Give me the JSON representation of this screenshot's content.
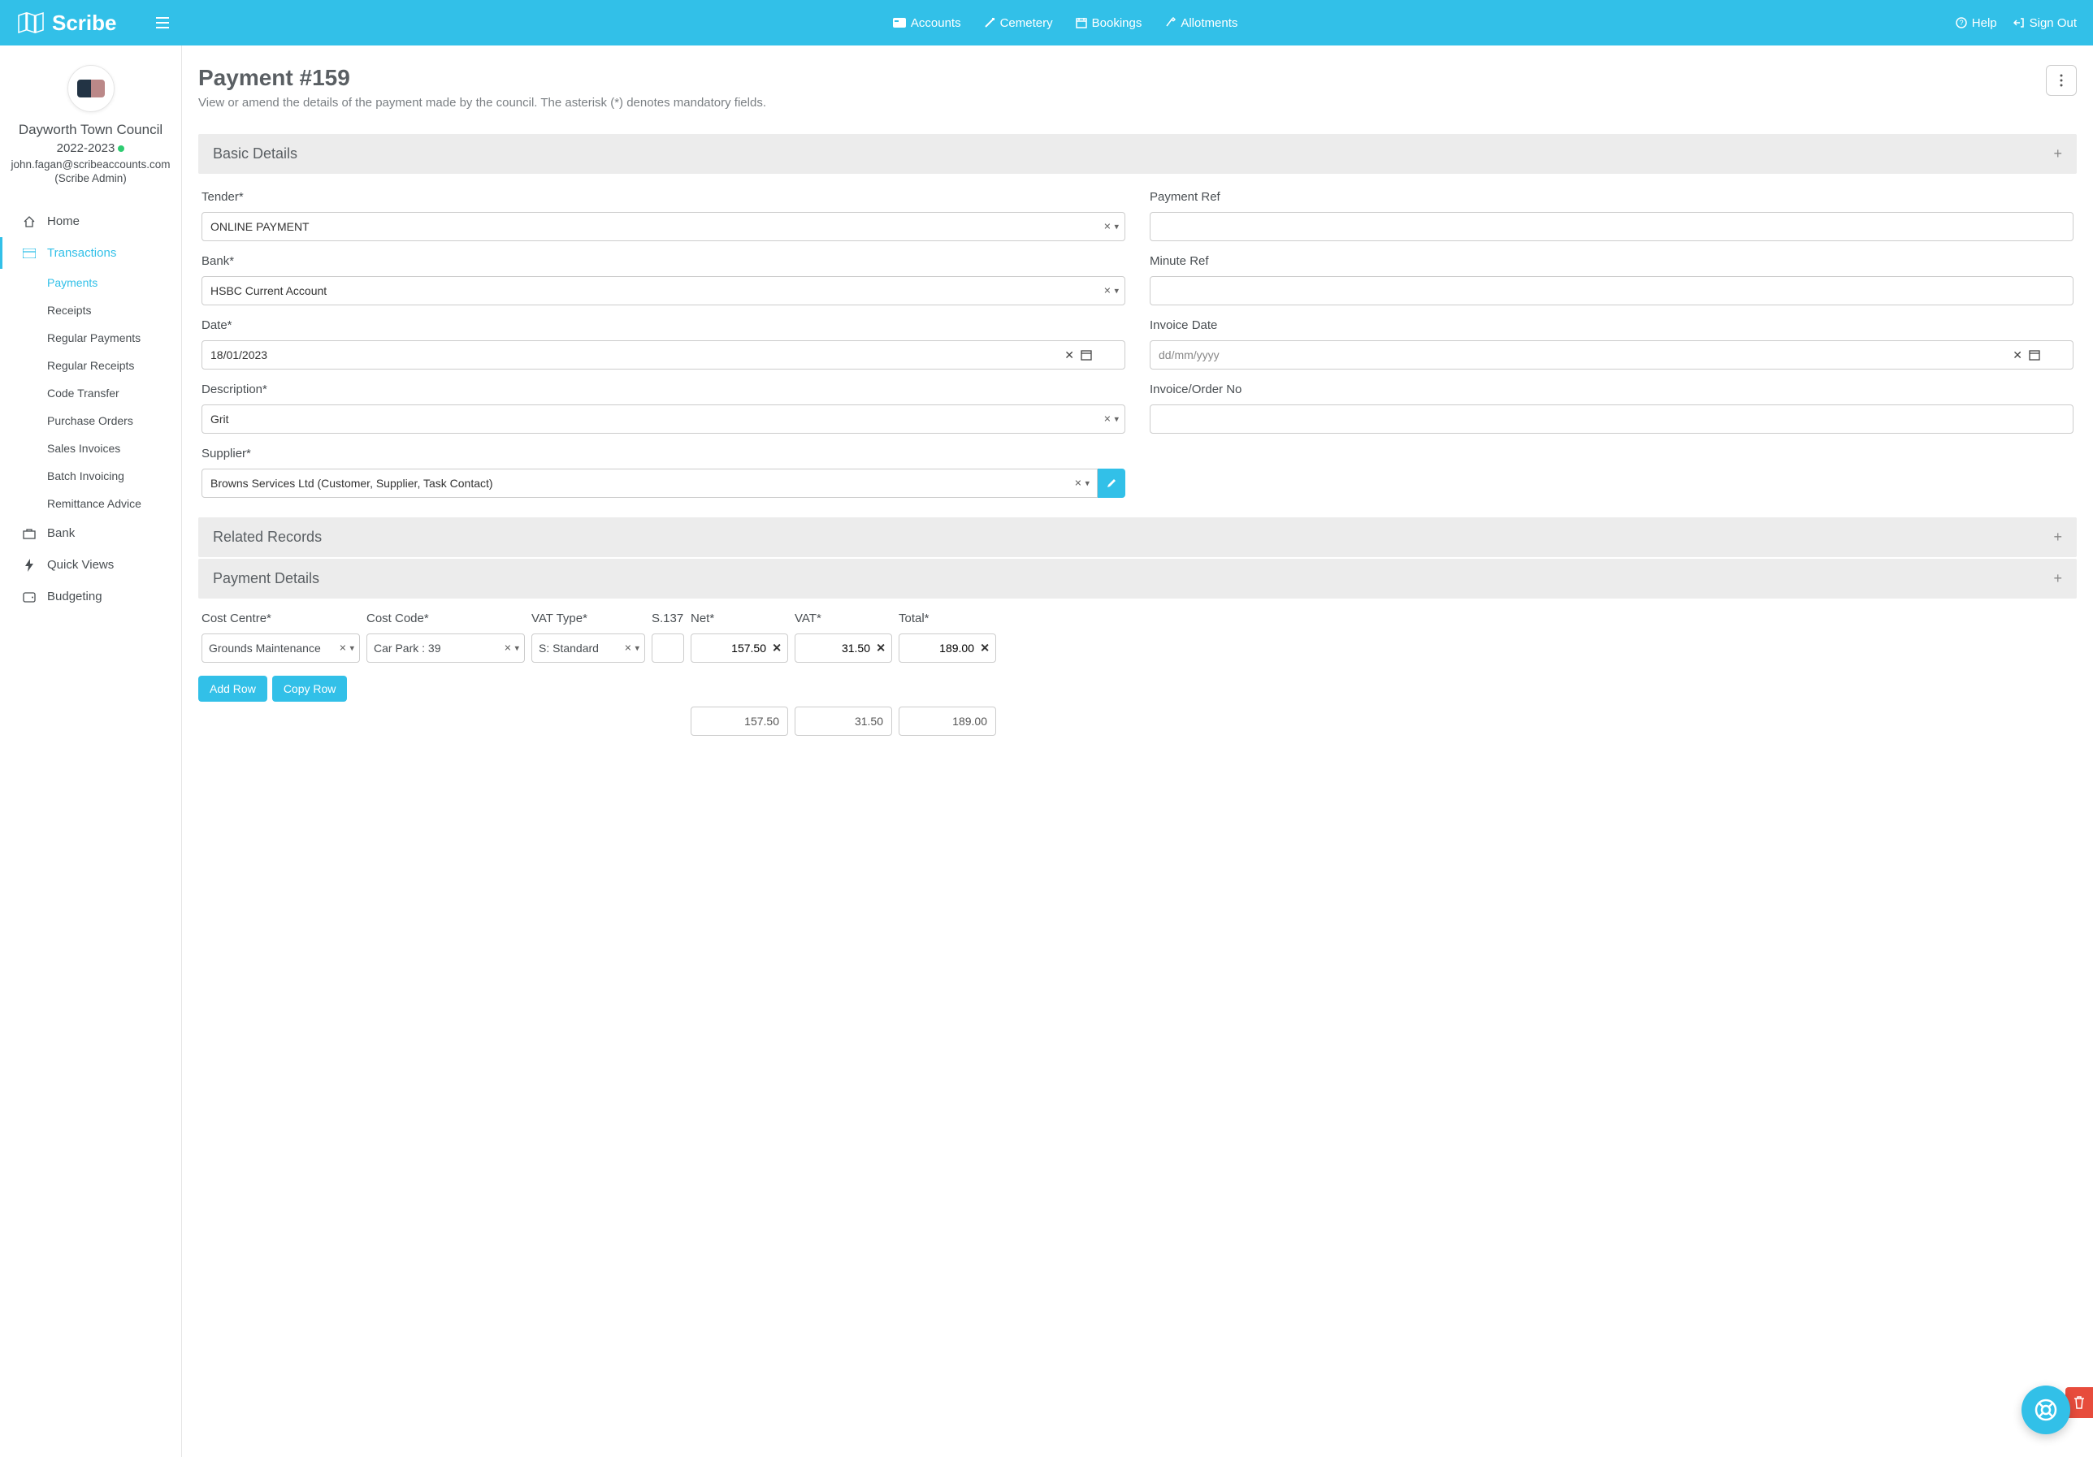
{
  "brand": "Scribe",
  "topnav": {
    "accounts": "Accounts",
    "cemetery": "Cemetery",
    "bookings": "Bookings",
    "allotments": "Allotments",
    "help": "Help",
    "signout": "Sign Out"
  },
  "org": {
    "name": "Dayworth Town Council",
    "year": "2022-2023",
    "email": "john.fagan@scribeaccounts.com",
    "role": "(Scribe Admin)"
  },
  "sidenav": {
    "home": "Home",
    "transactions": "Transactions",
    "subs": {
      "payments": "Payments",
      "receipts": "Receipts",
      "regular_payments": "Regular Payments",
      "regular_receipts": "Regular Receipts",
      "code_transfer": "Code Transfer",
      "purchase_orders": "Purchase Orders",
      "sales_invoices": "Sales Invoices",
      "batch_invoicing": "Batch Invoicing",
      "remittance_advice": "Remittance Advice"
    },
    "bank": "Bank",
    "quick_views": "Quick Views",
    "budgeting": "Budgeting"
  },
  "page": {
    "title": "Payment #159",
    "subtitle": "View or amend the details of the payment made by the council. The asterisk (*) denotes mandatory fields."
  },
  "sections": {
    "basic": "Basic Details",
    "related": "Related Records",
    "payment": "Payment Details"
  },
  "fields": {
    "tender_label": "Tender*",
    "tender_value": "ONLINE PAYMENT",
    "payment_ref_label": "Payment Ref",
    "payment_ref_value": "",
    "bank_label": "Bank*",
    "bank_value": "HSBC Current Account",
    "minute_ref_label": "Minute Ref",
    "minute_ref_value": "",
    "date_label": "Date*",
    "date_value": "18/01/2023",
    "invoice_date_label": "Invoice Date",
    "invoice_date_placeholder": "dd/mm/yyyy",
    "description_label": "Description*",
    "description_value": "Grit",
    "invoice_no_label": "Invoice/Order No",
    "invoice_no_value": "",
    "supplier_label": "Supplier*",
    "supplier_value": "Browns Services Ltd (Customer, Supplier, Task Contact)"
  },
  "detail_headers": {
    "cost_centre": "Cost Centre*",
    "cost_code": "Cost Code*",
    "vat_type": "VAT Type*",
    "s137": "S.137",
    "net": "Net*",
    "vat": "VAT*",
    "total": "Total*"
  },
  "detail_row": {
    "cost_centre": "Grounds Maintenance",
    "cost_code": "Car Park : 39",
    "vat_type": "S: Standard",
    "net": "157.50",
    "vat": "31.50",
    "total": "189.00"
  },
  "totals": {
    "net": "157.50",
    "vat": "31.50",
    "total": "189.00"
  },
  "buttons": {
    "add_row": "Add Row",
    "copy_row": "Copy Row"
  }
}
